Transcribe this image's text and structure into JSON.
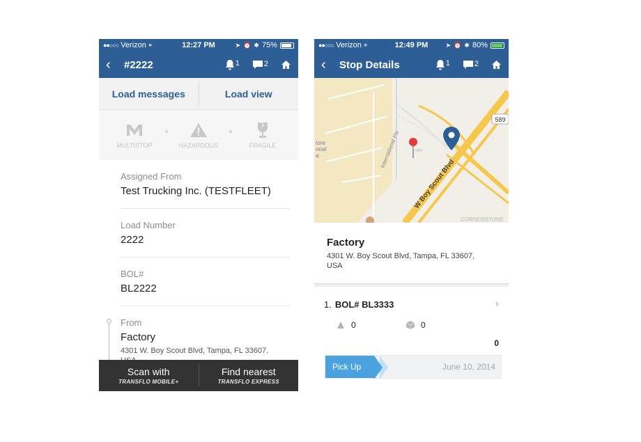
{
  "left": {
    "status": {
      "carrier": "Verizon",
      "time": "12:27 PM",
      "battery": "75%",
      "battery_level": 0.75
    },
    "nav": {
      "back": "‹",
      "title": "#2222",
      "alerts_count": "1",
      "messages_count": "2"
    },
    "tabs": {
      "messages": "Load messages",
      "view": "Load view"
    },
    "badges": [
      {
        "label": "MULTISTOP",
        "icon": "multistop-icon"
      },
      {
        "label": "HAZARDOUS",
        "icon": "hazard-icon"
      },
      {
        "label": "FRAGILE",
        "icon": "fragile-glass-icon"
      }
    ],
    "fields": [
      {
        "label": "Assigned From",
        "value": "Test Trucking Inc. (TESTFLEET)"
      },
      {
        "label": "Load Number",
        "value": "2222"
      },
      {
        "label": "BOL#",
        "value": "BL2222"
      }
    ],
    "from": {
      "label": "From",
      "name": "Factory",
      "address": "4301 W. Boy Scout Blvd, Tampa, FL 33607,",
      "address_cut": "USA"
    },
    "bottom": {
      "scan_title": "Scan with",
      "scan_brand": "TRANSFLO MOBILE+",
      "find_title": "Find nearest",
      "find_brand": "TRANSFLO EXPRESS"
    }
  },
  "right": {
    "status": {
      "carrier": "Verizon",
      "time": "12:49 PM",
      "battery": "80%",
      "battery_level": 0.8
    },
    "nav": {
      "back": "‹",
      "title": "Stop Details",
      "alerts_count": "1",
      "messages_count": "2"
    },
    "map": {
      "road_main": "W Boy Scout Blvd",
      "road_side": "International Plz",
      "shield": "589",
      "store_text_1": "tore",
      "store_text_2": "onal",
      "store_text_3": "a",
      "district": "CORNERSTONE"
    },
    "place": {
      "name": "Factory",
      "address_line1": "4301 W. Boy Scout Blvd, Tampa, FL 33607,",
      "address_line2": "USA"
    },
    "stop": {
      "index": "1.",
      "bol": "BOL# BL3333",
      "weight": "0",
      "pieces": "0",
      "total": "0"
    },
    "pickup": {
      "label": "Pick Up",
      "date": "June 10, 2014"
    }
  },
  "colors": {
    "brand": "#2d5e95",
    "accent": "#4aa3df",
    "map_land": "#f3e8c2",
    "map_road": "#f5c84b"
  }
}
